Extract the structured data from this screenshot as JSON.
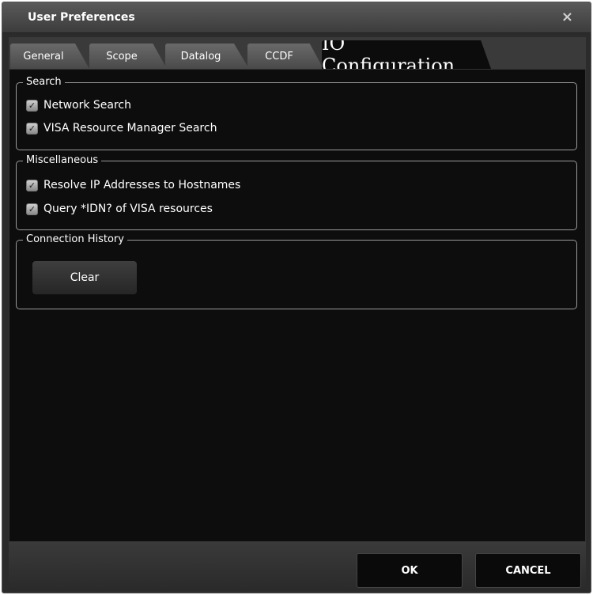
{
  "window": {
    "title": "User Preferences",
    "close_glyph": "×"
  },
  "tabs": [
    {
      "label": "General",
      "active": false
    },
    {
      "label": "Scope",
      "active": false
    },
    {
      "label": "Datalog",
      "active": false
    },
    {
      "label": "CCDF",
      "active": false
    },
    {
      "label": "IO Configuration",
      "active": true
    }
  ],
  "groups": {
    "search": {
      "label": "Search",
      "options": [
        {
          "label": "Network Search",
          "checked": true
        },
        {
          "label": "VISA Resource Manager Search",
          "checked": true
        }
      ]
    },
    "misc": {
      "label": "Miscellaneous",
      "options": [
        {
          "label": "Resolve IP Addresses to Hostnames",
          "checked": true
        },
        {
          "label": "Query *IDN? of VISA resources",
          "checked": true
        }
      ]
    },
    "history": {
      "label": "Connection History",
      "clear_label": "Clear"
    }
  },
  "footer": {
    "ok_label": "OK",
    "cancel_label": "CANCEL"
  },
  "icons": {
    "close": "close-icon",
    "checkbox": "checkbox-checked-icon"
  },
  "colors": {
    "background": "#0d0d0d",
    "frame": "#2b2b2b",
    "text": "#ffffff"
  }
}
